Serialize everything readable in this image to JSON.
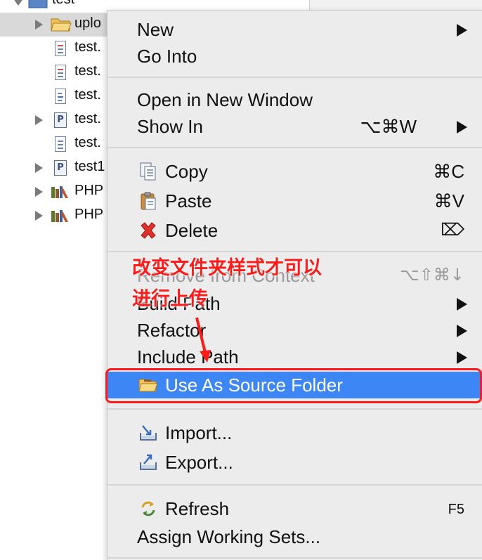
{
  "tree": {
    "items": [
      {
        "label": "test",
        "type": "project",
        "expanded": true
      },
      {
        "label": "uplo",
        "type": "folder",
        "selected": true
      },
      {
        "label": "test.",
        "type": "file"
      },
      {
        "label": "test.",
        "type": "file"
      },
      {
        "label": "test.",
        "type": "file-special"
      },
      {
        "label": "test.",
        "type": "php"
      },
      {
        "label": "test.",
        "type": "text"
      },
      {
        "label": "test1",
        "type": "php"
      },
      {
        "label": "PHP",
        "type": "library"
      },
      {
        "label": "PHP",
        "type": "library"
      }
    ]
  },
  "context_menu": {
    "new": {
      "label": "New"
    },
    "go_into": {
      "label": "Go Into"
    },
    "open_new_window": {
      "label": "Open in New Window"
    },
    "show_in": {
      "label": "Show In",
      "shortcut": "⌥⌘W"
    },
    "copy": {
      "label": "Copy",
      "shortcut": "⌘C"
    },
    "paste": {
      "label": "Paste",
      "shortcut": "⌘V"
    },
    "delete": {
      "label": "Delete",
      "shortcut": "⌦"
    },
    "remove_context": {
      "label": "Remove from Context",
      "shortcut": "⌥⇧⌘↓"
    },
    "build_path": {
      "label": "Build Path"
    },
    "refactor": {
      "label": "Refactor"
    },
    "include_path": {
      "label": "Include Path"
    },
    "use_as_source": {
      "label": "Use As Source Folder"
    },
    "import": {
      "label": "Import..."
    },
    "export": {
      "label": "Export..."
    },
    "refresh": {
      "label": "Refresh",
      "shortcut": "F5"
    },
    "assign_working_sets": {
      "label": "Assign Working Sets..."
    }
  },
  "annotation": {
    "line1": "改变文件夹样式才可以",
    "line2": "进行上传"
  },
  "colors": {
    "highlight": "#3d86f5",
    "annotation": "#ff1a1a",
    "menu_bg": "#ececec"
  }
}
